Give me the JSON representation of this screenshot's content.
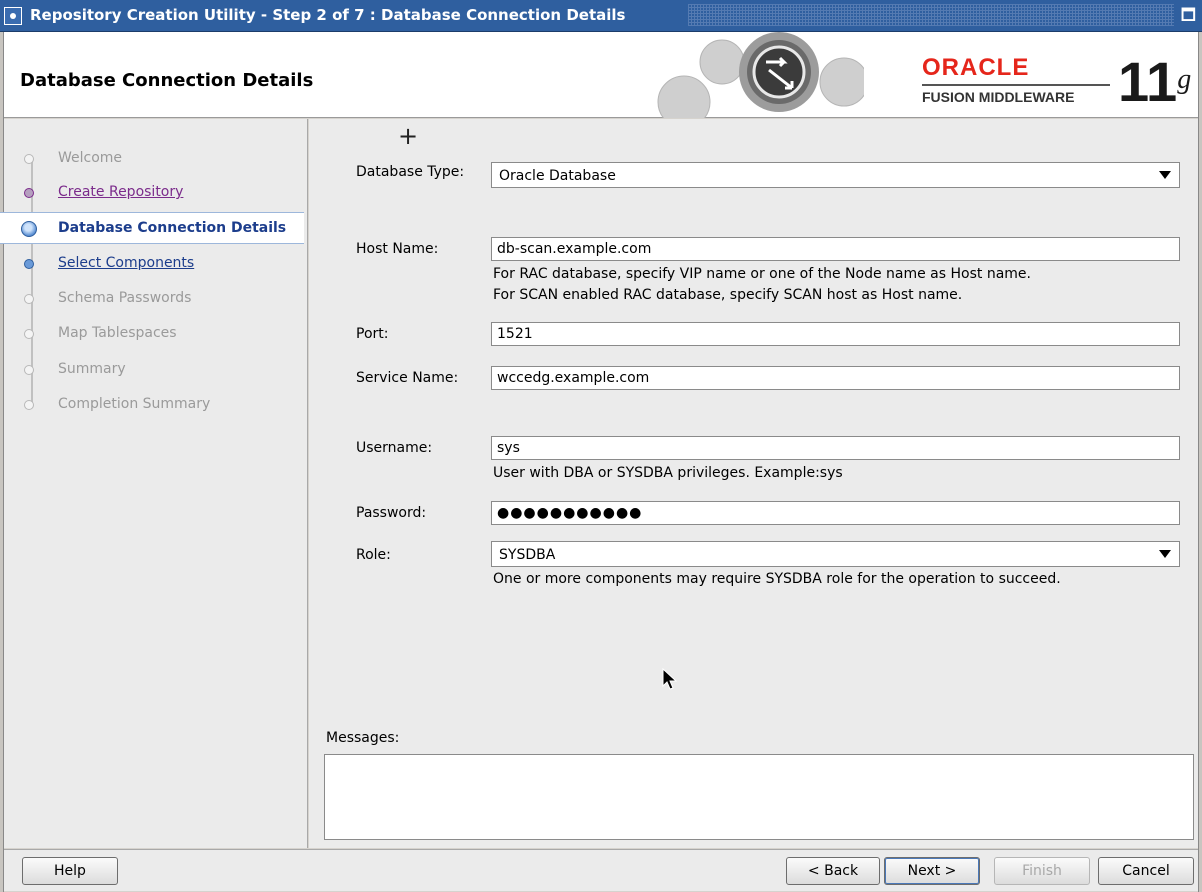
{
  "window": {
    "title": "Repository Creation Utility - Step 2 of 7 : Database Connection Details"
  },
  "header": {
    "page_title": "Database Connection Details",
    "logo_oracle": "ORACLE",
    "logo_fusion": "FUSION MIDDLEWARE",
    "logo_version": "11",
    "logo_version_suffix": "g"
  },
  "nav": {
    "items": [
      {
        "label": "Welcome",
        "state": "disabled"
      },
      {
        "label": "Create Repository",
        "state": "visited"
      },
      {
        "label": "Database Connection Details",
        "state": "current"
      },
      {
        "label": "Select Components",
        "state": "link"
      },
      {
        "label": "Schema Passwords",
        "state": "disabled"
      },
      {
        "label": "Map Tablespaces",
        "state": "disabled"
      },
      {
        "label": "Summary",
        "state": "disabled"
      },
      {
        "label": "Completion Summary",
        "state": "disabled"
      }
    ]
  },
  "form": {
    "database_type": {
      "label": "Database Type:",
      "value": "Oracle Database"
    },
    "host_name": {
      "label": "Host Name:",
      "value": "db-scan.example.com",
      "hint1": "For RAC database, specify VIP name or one of the Node name as Host name.",
      "hint2": "For SCAN enabled RAC database, specify SCAN host as Host name."
    },
    "port": {
      "label": "Port:",
      "value": "1521"
    },
    "service_name": {
      "label": "Service Name:",
      "value": "wccedg.example.com"
    },
    "username": {
      "label": "Username:",
      "value": "sys",
      "hint": "User with DBA or SYSDBA privileges. Example:sys"
    },
    "password": {
      "label": "Password:",
      "value": "●●●●●●●●●●●"
    },
    "role": {
      "label": "Role:",
      "value": "SYSDBA",
      "hint": "One or more components may require SYSDBA role for the operation to succeed."
    }
  },
  "messages": {
    "label": "Messages:"
  },
  "footer": {
    "help": "Help",
    "back": "< Back",
    "next": "Next >",
    "finish": "Finish",
    "cancel": "Cancel"
  },
  "colors": {
    "titlebar": "#2f5f9f",
    "oracle_red": "#e5261b",
    "nav_current": "#1c3d8c",
    "visited": "#7b2b8b"
  }
}
